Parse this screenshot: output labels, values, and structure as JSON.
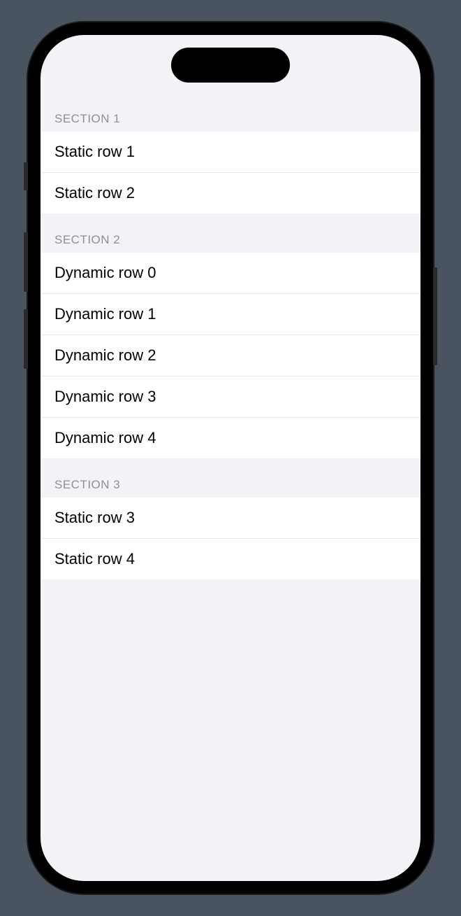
{
  "sections": [
    {
      "header": "Section 1",
      "rows": [
        {
          "label": "Static row 1"
        },
        {
          "label": "Static row 2"
        }
      ]
    },
    {
      "header": "Section 2",
      "rows": [
        {
          "label": "Dynamic row 0"
        },
        {
          "label": "Dynamic row 1"
        },
        {
          "label": "Dynamic row 2"
        },
        {
          "label": "Dynamic row 3"
        },
        {
          "label": "Dynamic row 4"
        }
      ]
    },
    {
      "header": "Section 3",
      "rows": [
        {
          "label": "Static row 3"
        },
        {
          "label": "Static row 4"
        }
      ]
    }
  ]
}
